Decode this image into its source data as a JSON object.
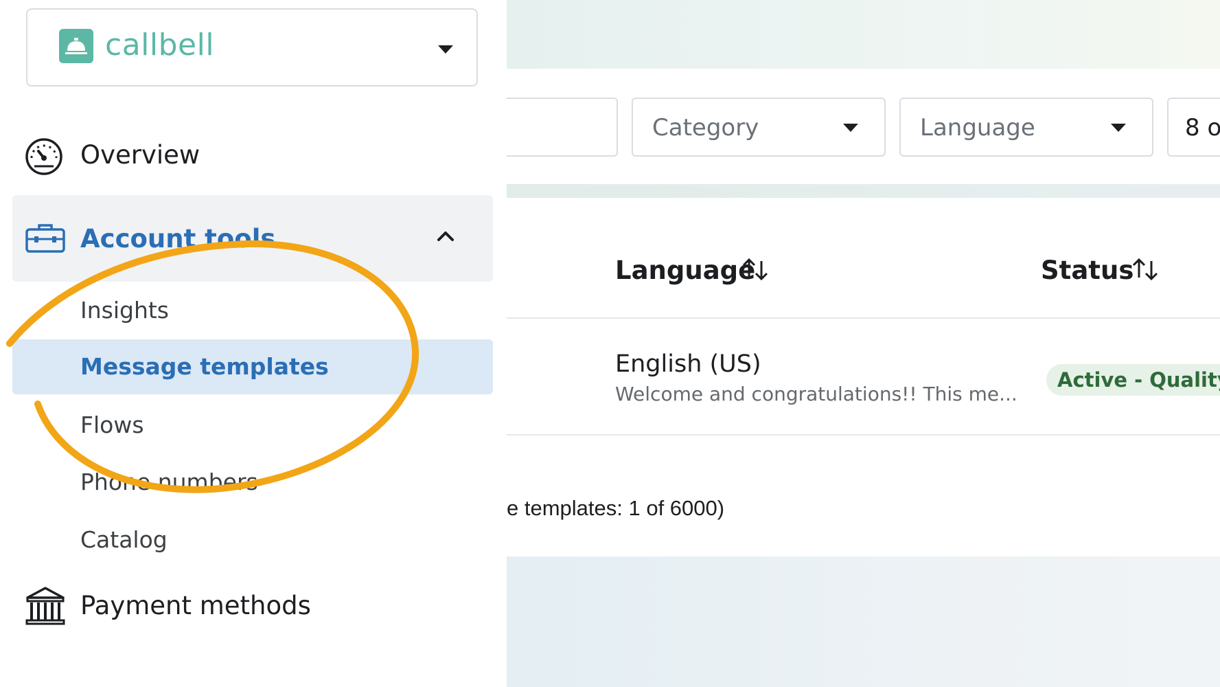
{
  "brand": {
    "name": "callbell",
    "accent": "#5ab8a6"
  },
  "sidebar": {
    "overview_label": "Overview",
    "account_tools_label": "Account tools",
    "sub_items": [
      {
        "label": "Insights",
        "active": false
      },
      {
        "label": "Message templates",
        "active": true
      },
      {
        "label": "Flows",
        "active": false
      },
      {
        "label": "Phone numbers",
        "active": false
      },
      {
        "label": "Catalog",
        "active": false
      }
    ],
    "payment_label": "Payment methods",
    "active_color": "#2a6eb5"
  },
  "filters": {
    "category_placeholder": "Category",
    "language_placeholder": "Language",
    "count_text": "8 o"
  },
  "table": {
    "columns": [
      {
        "label": "Language",
        "sortable": true
      },
      {
        "label": "Status",
        "sortable": true
      }
    ],
    "rows": [
      {
        "language": "English (US)",
        "preview": "Welcome and congratulations!! This me...",
        "status": "Active - Quality p"
      }
    ]
  },
  "footer": {
    "templates_count_text": "e templates: 1 of 6000)"
  },
  "annotation": {
    "shape": "hand-drawn circle",
    "color": "#f2a516",
    "target": "Message templates"
  }
}
